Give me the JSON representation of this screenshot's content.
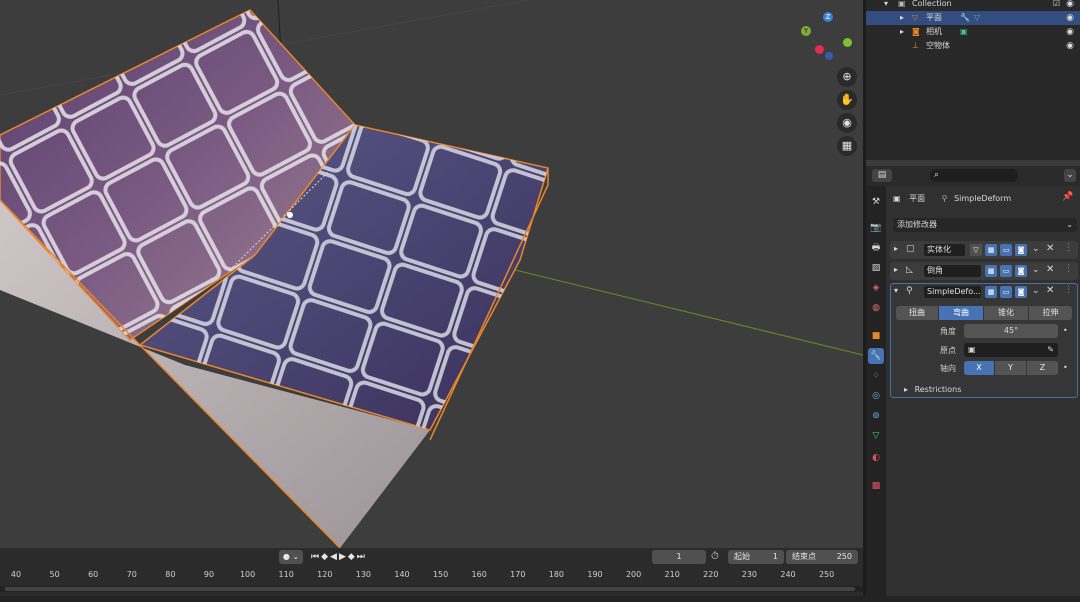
{
  "outliner": {
    "rows": [
      {
        "label": "Collection"
      },
      {
        "label": "平面"
      },
      {
        "label": "相机"
      },
      {
        "label": "空物体"
      }
    ]
  },
  "properties": {
    "object_name": "平面",
    "modifier_name": "SimpleDeform",
    "add_modifier": "添加修改器",
    "modifiers": [
      {
        "name": "实体化"
      },
      {
        "name": "倒角"
      },
      {
        "name": "SimpleDefo..."
      }
    ],
    "deform_modes": [
      "扭曲",
      "弯曲",
      "锥化",
      "拉伸"
    ],
    "angle_label": "角度",
    "angle_value": "45°",
    "origin_label": "原点",
    "axis_label": "轴向",
    "axes": [
      "X",
      "Y",
      "Z"
    ],
    "restrictions": "Restrictions"
  },
  "timeline": {
    "current_frame": "1",
    "start_label": "起始",
    "start_value": "1",
    "end_label": "结束点",
    "end_value": "250",
    "ticks": [
      "40",
      "50",
      "60",
      "70",
      "80",
      "90",
      "100",
      "110",
      "120",
      "130",
      "140",
      "150",
      "160",
      "170",
      "180",
      "190",
      "200",
      "210",
      "220",
      "230",
      "240",
      "250"
    ]
  },
  "colors": {
    "selection": "#334d80",
    "accent": "#4772b3",
    "object_outline": "#e8862a"
  }
}
